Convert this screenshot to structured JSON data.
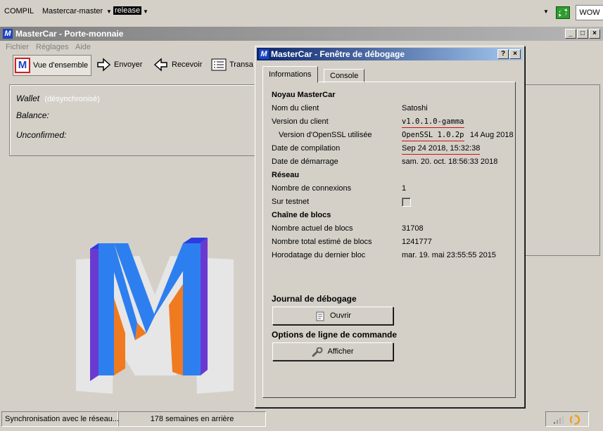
{
  "topbar": {
    "compil": "COMPIL",
    "branch": "Mastercar-master",
    "build": "release",
    "wow": "WOW"
  },
  "main_window": {
    "title": "MasterCar - Porte-monnaie",
    "menu": [
      "Fichier",
      "Réglages",
      "Aide"
    ],
    "toolbar": {
      "overview": "Vue d'ensemble",
      "send": "Envoyer",
      "receive": "Recevoir",
      "transactions": "Transa"
    },
    "wallet": {
      "label": "Wallet",
      "sync_state": "(désynchronisé)",
      "balance_label": "Balance:",
      "unconfirmed_label": "Unconfirmed:"
    },
    "status": {
      "sync_text": "Synchronisation avec le réseau...",
      "behind_text": "178 semaines en arrière"
    }
  },
  "debug_window": {
    "title": "MasterCar - Fenêtre de débogage",
    "tabs": [
      "Informations",
      "Console"
    ],
    "sections": {
      "core": "Noyau MasterCar",
      "network": "Réseau",
      "blockchain": "Chaîne de blocs",
      "debug_log": "Journal de débogage",
      "cmdline": "Options de ligne de commande"
    },
    "fields": {
      "client_name_label": "Nom du client",
      "client_name": "Satoshi",
      "client_version_label": "Version du client",
      "client_version": "v1.0.1.0-gamma",
      "openssl_label": "Version d'OpenSSL utilisée",
      "openssl_version": "OpenSSL 1.0.2p",
      "openssl_date": "14 Aug 2018",
      "build_date_label": "Date de compilation",
      "build_date": "Sep 24 2018, 15:32:38",
      "startup_label": "Date de démarrage",
      "startup_date": "sam. 20. oct. 18:56:33 2018",
      "connections_label": "Nombre de connexions",
      "connections": "1",
      "testnet_label": "Sur testnet",
      "blocks_label": "Nombre actuel de blocs",
      "blocks": "31708",
      "total_blocks_label": "Nombre total estimé de blocs",
      "total_blocks": "1241777",
      "last_block_label": "Horodatage du dernier bloc",
      "last_block": "mar. 19. mai 23:55:55 2015"
    },
    "buttons": {
      "open": "Ouvrir",
      "show": "Afficher"
    }
  },
  "colors": {
    "accent_underline": "#d01010",
    "title_active": "#0a246a",
    "logo_blue": "#2d7ff0",
    "logo_purple": "#6a3ad0",
    "logo_orange": "#f07a20"
  }
}
